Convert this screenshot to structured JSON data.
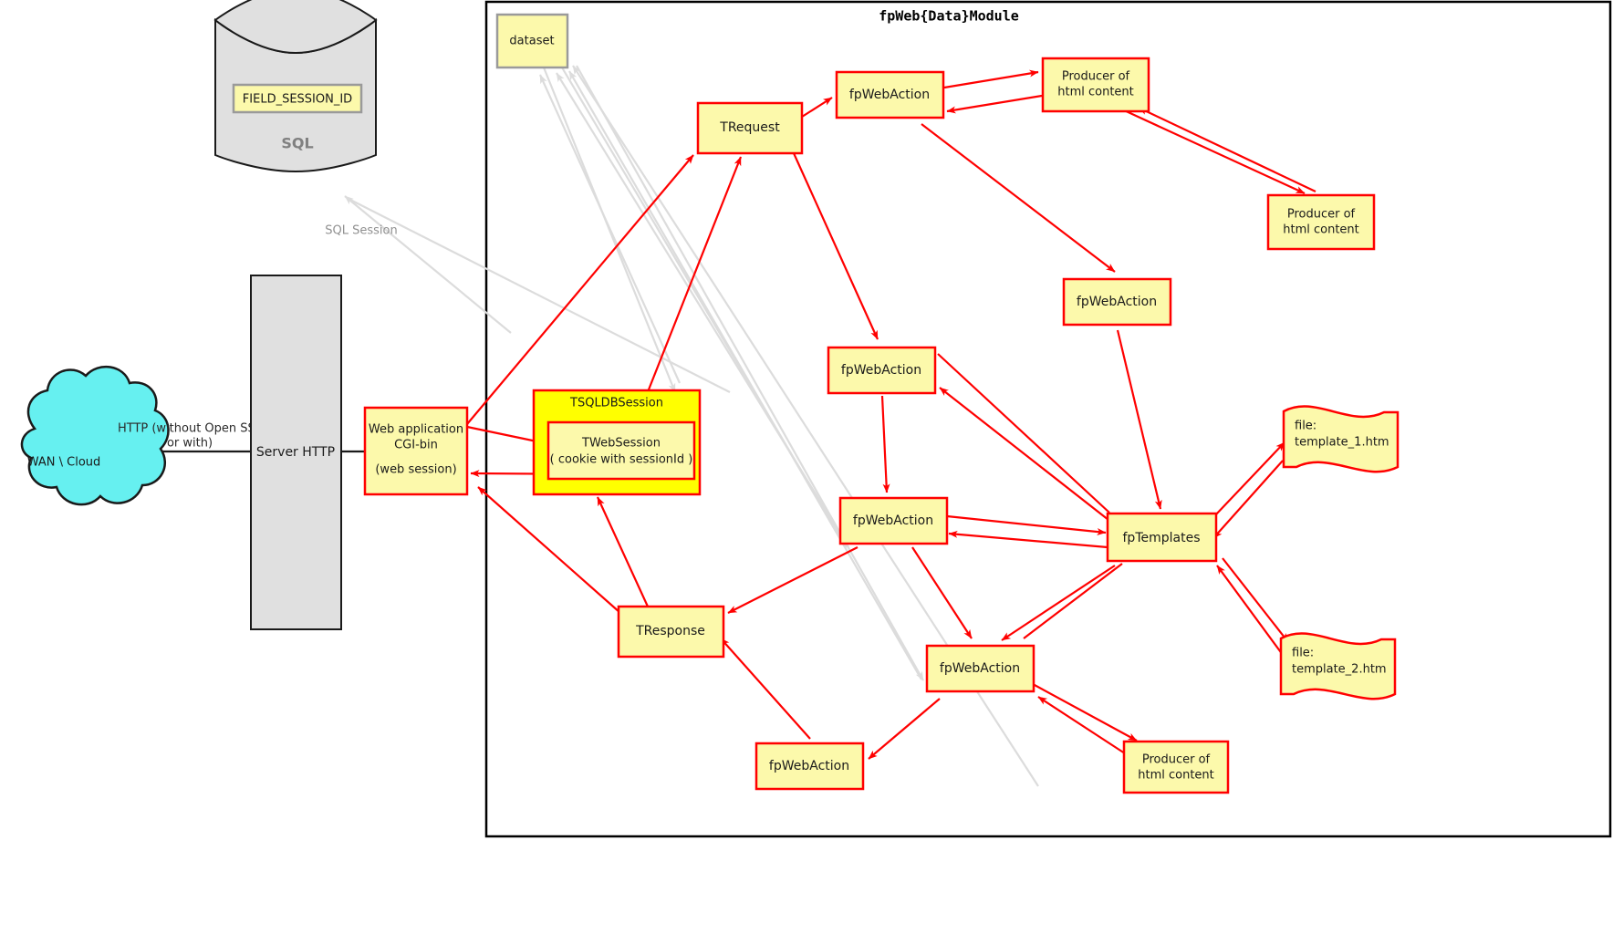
{
  "diagram": {
    "module_title": "fpWeb{Data}Module",
    "database": {
      "field_label": "FIELD_SESSION_ID",
      "name_label": "SQL"
    },
    "cloud": {
      "label": "WAN \\ Cloud"
    },
    "server": {
      "label": "Server HTTP"
    },
    "webapp": {
      "line1": "Web application",
      "line2": "CGI-bin",
      "line3": "(web session)"
    },
    "session": {
      "outer_label": "TSQLDBSession",
      "inner_line1": "TWebSession",
      "inner_line2": "( cookie with sessionId )"
    },
    "edges": {
      "http_line1": "HTTP (without Open SSL",
      "http_line2": "or with)",
      "sql_session": "SQL Session"
    },
    "nodes": {
      "dataset": "dataset",
      "trequest": "TRequest",
      "tresponse": "TResponse",
      "fp_templates": "fpTemplates",
      "action_1": "fpWebAction",
      "action_2": "fpWebAction",
      "action_3": "fpWebAction",
      "action_4": "fpWebAction",
      "action_5": "fpWebAction",
      "action_6": "fpWebAction",
      "producer_1_line1": "Producer of",
      "producer_1_line2": "html content",
      "producer_2_line1": "Producer of",
      "producer_2_line2": "html content",
      "producer_3_line1": "Producer of",
      "producer_3_line2": "html content",
      "file_1_line1": "file:",
      "file_1_line2": "template_1.htm",
      "file_2_line1": "file:",
      "file_2_line2": "template_2.htm"
    },
    "colors": {
      "node_fill": "#fcf9ab",
      "node_stroke": "#ff0000",
      "session_fill": "#ffff00",
      "db_fill": "#e0e0e0",
      "cloud_fill": "#66f0f0",
      "gray_edge": "#dcdcdc",
      "red_edge": "#ff0000"
    }
  }
}
